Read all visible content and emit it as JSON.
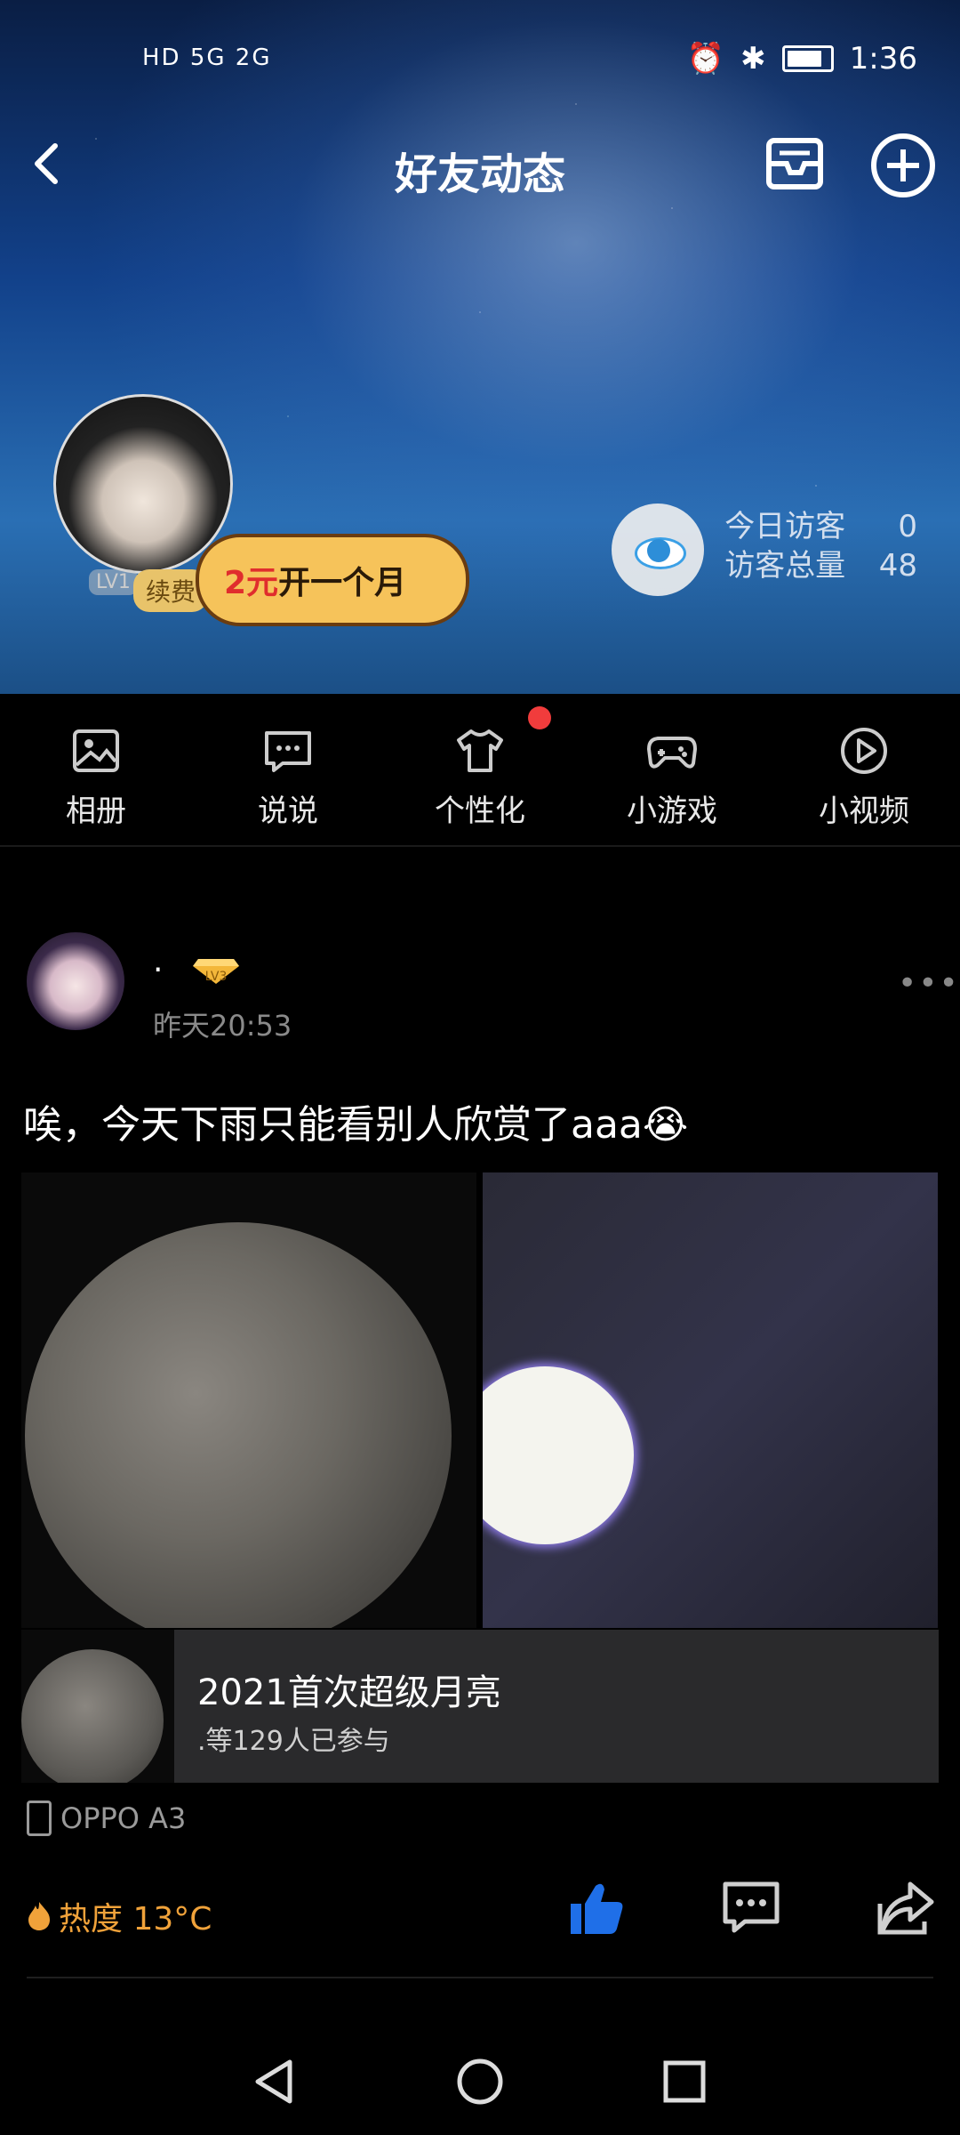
{
  "status_bar": {
    "left": "HD 5G 2G",
    "time": "1:36"
  },
  "header": {
    "title": "好友动态"
  },
  "profile": {
    "level": "LV1",
    "renew_label": "续费",
    "promo_price": "2元",
    "promo_text": "开一个月",
    "visits": {
      "today_label": "今日访客",
      "today_value": "0",
      "total_label": "访客总量",
      "total_value": "48"
    }
  },
  "nav": {
    "items": [
      {
        "label": "相册",
        "icon": "photo-album-icon"
      },
      {
        "label": "说说",
        "icon": "chat-bubble-icon"
      },
      {
        "label": "个性化",
        "icon": "tshirt-icon"
      },
      {
        "label": "小游戏",
        "icon": "gamepad-icon"
      },
      {
        "label": "小视频",
        "icon": "play-circle-icon"
      }
    ]
  },
  "post": {
    "author": ".",
    "author_level": "LV3",
    "time": "昨天20:53",
    "text": "唉，今天下雨只能看别人欣赏了aaa😭",
    "topic": {
      "title": "2021首次超级月亮",
      "subtitle": ".等129人已参与"
    },
    "device": "OPPO A3",
    "heat": "热度 13°C"
  },
  "colors": {
    "accent_like": "#1f6fe8",
    "heat": "#f0a23a",
    "badge_red": "#f13c3c"
  }
}
